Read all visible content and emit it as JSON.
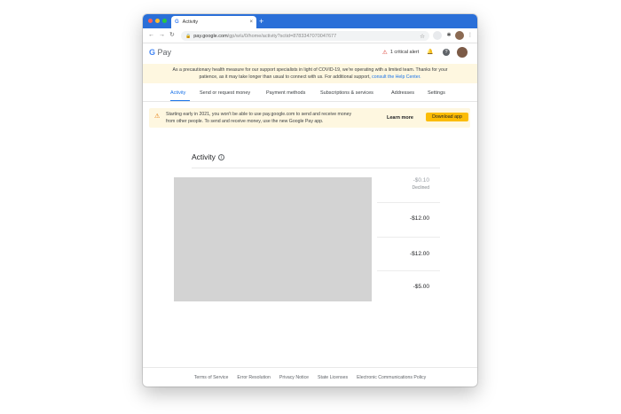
{
  "browser": {
    "tab_title": "Activity",
    "tab_favicon": "G",
    "close_glyph": "×",
    "new_tab_glyph": "+",
    "url_host": "pay.google.com",
    "url_path": "/gp/w/u/0/home/activity?sctid=8783347070047677",
    "back_glyph": "←",
    "forward_glyph": "→",
    "reload_glyph": "↻",
    "star_glyph": "☆",
    "ext_glyph": "✱",
    "menu_glyph": "⋮"
  },
  "header": {
    "logo_g": "G",
    "logo_text": "Pay",
    "alert_text": "1 critical alert",
    "alert_icon": "⚠",
    "bell_icon": "🔔",
    "help_icon": "?"
  },
  "covid_banner": {
    "line1": "As a precautionary health measure for our support specialists in light of COVID-19, we're operating with a limited team. Thanks for your",
    "line2": "patience, as it may take longer than usual to connect with us. For additional support,",
    "link": "consult the Help Center."
  },
  "tabs": [
    {
      "label": "Activity"
    },
    {
      "label": "Send or request money"
    },
    {
      "label": "Payment methods"
    },
    {
      "label": "Subscriptions & services"
    },
    {
      "label": "Addresses"
    },
    {
      "label": "Settings"
    }
  ],
  "notice": {
    "icon": "⚠",
    "line1": "Starting early in 2021, you won't be able to use pay.google.com to send and receive money",
    "line2": "from other people. To send and receive money, use the new Google Pay app.",
    "learn_more": "Learn more",
    "download": "Download app"
  },
  "activity": {
    "title": "Activity",
    "info_icon": "i",
    "transactions": [
      {
        "amount": "-$0.10",
        "status": "Declined"
      },
      {
        "amount": "-$12.00",
        "status": ""
      },
      {
        "amount": "-$12.00",
        "status": ""
      },
      {
        "amount": "-$5.00",
        "status": ""
      }
    ]
  },
  "footer": {
    "links": [
      "Terms of Service",
      "Error Resolution",
      "Privacy Notice",
      "State Licenses",
      "Electronic Communications Policy"
    ]
  },
  "colors": {
    "accent": "#1a73e8",
    "banner": "#fef7e0",
    "download_button": "#fbbc04",
    "tabstrip": "#2a6fd8"
  }
}
